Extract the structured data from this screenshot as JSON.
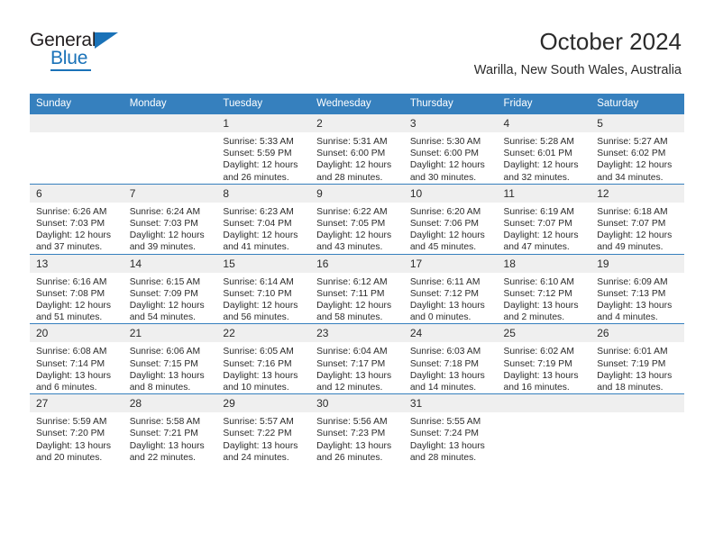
{
  "logo": {
    "word1": "General",
    "word2": "Blue",
    "triangle_color": "#1a72b8",
    "text_color": "#231f20"
  },
  "header": {
    "month_title": "October 2024",
    "location": "Warilla, New South Wales, Australia"
  },
  "theme": {
    "header_bg": "#3680be",
    "daynum_bg": "#efefef",
    "row_divider": "#3680be",
    "text": "#2b2b2b"
  },
  "calendar": {
    "weekday_headers": [
      "Sunday",
      "Monday",
      "Tuesday",
      "Wednesday",
      "Thursday",
      "Friday",
      "Saturday"
    ],
    "weeks": [
      [
        {
          "day": "",
          "sunrise": "",
          "sunset": "",
          "daylight_line1": "",
          "daylight_line2": "",
          "empty": true
        },
        {
          "day": "",
          "sunrise": "",
          "sunset": "",
          "daylight_line1": "",
          "daylight_line2": "",
          "empty": true
        },
        {
          "day": "1",
          "sunrise": "Sunrise: 5:33 AM",
          "sunset": "Sunset: 5:59 PM",
          "daylight_line1": "Daylight: 12 hours",
          "daylight_line2": "and 26 minutes."
        },
        {
          "day": "2",
          "sunrise": "Sunrise: 5:31 AM",
          "sunset": "Sunset: 6:00 PM",
          "daylight_line1": "Daylight: 12 hours",
          "daylight_line2": "and 28 minutes."
        },
        {
          "day": "3",
          "sunrise": "Sunrise: 5:30 AM",
          "sunset": "Sunset: 6:00 PM",
          "daylight_line1": "Daylight: 12 hours",
          "daylight_line2": "and 30 minutes."
        },
        {
          "day": "4",
          "sunrise": "Sunrise: 5:28 AM",
          "sunset": "Sunset: 6:01 PM",
          "daylight_line1": "Daylight: 12 hours",
          "daylight_line2": "and 32 minutes."
        },
        {
          "day": "5",
          "sunrise": "Sunrise: 5:27 AM",
          "sunset": "Sunset: 6:02 PM",
          "daylight_line1": "Daylight: 12 hours",
          "daylight_line2": "and 34 minutes."
        }
      ],
      [
        {
          "day": "6",
          "sunrise": "Sunrise: 6:26 AM",
          "sunset": "Sunset: 7:03 PM",
          "daylight_line1": "Daylight: 12 hours",
          "daylight_line2": "and 37 minutes."
        },
        {
          "day": "7",
          "sunrise": "Sunrise: 6:24 AM",
          "sunset": "Sunset: 7:03 PM",
          "daylight_line1": "Daylight: 12 hours",
          "daylight_line2": "and 39 minutes."
        },
        {
          "day": "8",
          "sunrise": "Sunrise: 6:23 AM",
          "sunset": "Sunset: 7:04 PM",
          "daylight_line1": "Daylight: 12 hours",
          "daylight_line2": "and 41 minutes."
        },
        {
          "day": "9",
          "sunrise": "Sunrise: 6:22 AM",
          "sunset": "Sunset: 7:05 PM",
          "daylight_line1": "Daylight: 12 hours",
          "daylight_line2": "and 43 minutes."
        },
        {
          "day": "10",
          "sunrise": "Sunrise: 6:20 AM",
          "sunset": "Sunset: 7:06 PM",
          "daylight_line1": "Daylight: 12 hours",
          "daylight_line2": "and 45 minutes."
        },
        {
          "day": "11",
          "sunrise": "Sunrise: 6:19 AM",
          "sunset": "Sunset: 7:07 PM",
          "daylight_line1": "Daylight: 12 hours",
          "daylight_line2": "and 47 minutes."
        },
        {
          "day": "12",
          "sunrise": "Sunrise: 6:18 AM",
          "sunset": "Sunset: 7:07 PM",
          "daylight_line1": "Daylight: 12 hours",
          "daylight_line2": "and 49 minutes."
        }
      ],
      [
        {
          "day": "13",
          "sunrise": "Sunrise: 6:16 AM",
          "sunset": "Sunset: 7:08 PM",
          "daylight_line1": "Daylight: 12 hours",
          "daylight_line2": "and 51 minutes."
        },
        {
          "day": "14",
          "sunrise": "Sunrise: 6:15 AM",
          "sunset": "Sunset: 7:09 PM",
          "daylight_line1": "Daylight: 12 hours",
          "daylight_line2": "and 54 minutes."
        },
        {
          "day": "15",
          "sunrise": "Sunrise: 6:14 AM",
          "sunset": "Sunset: 7:10 PM",
          "daylight_line1": "Daylight: 12 hours",
          "daylight_line2": "and 56 minutes."
        },
        {
          "day": "16",
          "sunrise": "Sunrise: 6:12 AM",
          "sunset": "Sunset: 7:11 PM",
          "daylight_line1": "Daylight: 12 hours",
          "daylight_line2": "and 58 minutes."
        },
        {
          "day": "17",
          "sunrise": "Sunrise: 6:11 AM",
          "sunset": "Sunset: 7:12 PM",
          "daylight_line1": "Daylight: 13 hours",
          "daylight_line2": "and 0 minutes."
        },
        {
          "day": "18",
          "sunrise": "Sunrise: 6:10 AM",
          "sunset": "Sunset: 7:12 PM",
          "daylight_line1": "Daylight: 13 hours",
          "daylight_line2": "and 2 minutes."
        },
        {
          "day": "19",
          "sunrise": "Sunrise: 6:09 AM",
          "sunset": "Sunset: 7:13 PM",
          "daylight_line1": "Daylight: 13 hours",
          "daylight_line2": "and 4 minutes."
        }
      ],
      [
        {
          "day": "20",
          "sunrise": "Sunrise: 6:08 AM",
          "sunset": "Sunset: 7:14 PM",
          "daylight_line1": "Daylight: 13 hours",
          "daylight_line2": "and 6 minutes."
        },
        {
          "day": "21",
          "sunrise": "Sunrise: 6:06 AM",
          "sunset": "Sunset: 7:15 PM",
          "daylight_line1": "Daylight: 13 hours",
          "daylight_line2": "and 8 minutes."
        },
        {
          "day": "22",
          "sunrise": "Sunrise: 6:05 AM",
          "sunset": "Sunset: 7:16 PM",
          "daylight_line1": "Daylight: 13 hours",
          "daylight_line2": "and 10 minutes."
        },
        {
          "day": "23",
          "sunrise": "Sunrise: 6:04 AM",
          "sunset": "Sunset: 7:17 PM",
          "daylight_line1": "Daylight: 13 hours",
          "daylight_line2": "and 12 minutes."
        },
        {
          "day": "24",
          "sunrise": "Sunrise: 6:03 AM",
          "sunset": "Sunset: 7:18 PM",
          "daylight_line1": "Daylight: 13 hours",
          "daylight_line2": "and 14 minutes."
        },
        {
          "day": "25",
          "sunrise": "Sunrise: 6:02 AM",
          "sunset": "Sunset: 7:19 PM",
          "daylight_line1": "Daylight: 13 hours",
          "daylight_line2": "and 16 minutes."
        },
        {
          "day": "26",
          "sunrise": "Sunrise: 6:01 AM",
          "sunset": "Sunset: 7:19 PM",
          "daylight_line1": "Daylight: 13 hours",
          "daylight_line2": "and 18 minutes."
        }
      ],
      [
        {
          "day": "27",
          "sunrise": "Sunrise: 5:59 AM",
          "sunset": "Sunset: 7:20 PM",
          "daylight_line1": "Daylight: 13 hours",
          "daylight_line2": "and 20 minutes."
        },
        {
          "day": "28",
          "sunrise": "Sunrise: 5:58 AM",
          "sunset": "Sunset: 7:21 PM",
          "daylight_line1": "Daylight: 13 hours",
          "daylight_line2": "and 22 minutes."
        },
        {
          "day": "29",
          "sunrise": "Sunrise: 5:57 AM",
          "sunset": "Sunset: 7:22 PM",
          "daylight_line1": "Daylight: 13 hours",
          "daylight_line2": "and 24 minutes."
        },
        {
          "day": "30",
          "sunrise": "Sunrise: 5:56 AM",
          "sunset": "Sunset: 7:23 PM",
          "daylight_line1": "Daylight: 13 hours",
          "daylight_line2": "and 26 minutes."
        },
        {
          "day": "31",
          "sunrise": "Sunrise: 5:55 AM",
          "sunset": "Sunset: 7:24 PM",
          "daylight_line1": "Daylight: 13 hours",
          "daylight_line2": "and 28 minutes."
        },
        {
          "day": "",
          "sunrise": "",
          "sunset": "",
          "daylight_line1": "",
          "daylight_line2": "",
          "empty": true
        },
        {
          "day": "",
          "sunrise": "",
          "sunset": "",
          "daylight_line1": "",
          "daylight_line2": "",
          "empty": true
        }
      ]
    ]
  }
}
